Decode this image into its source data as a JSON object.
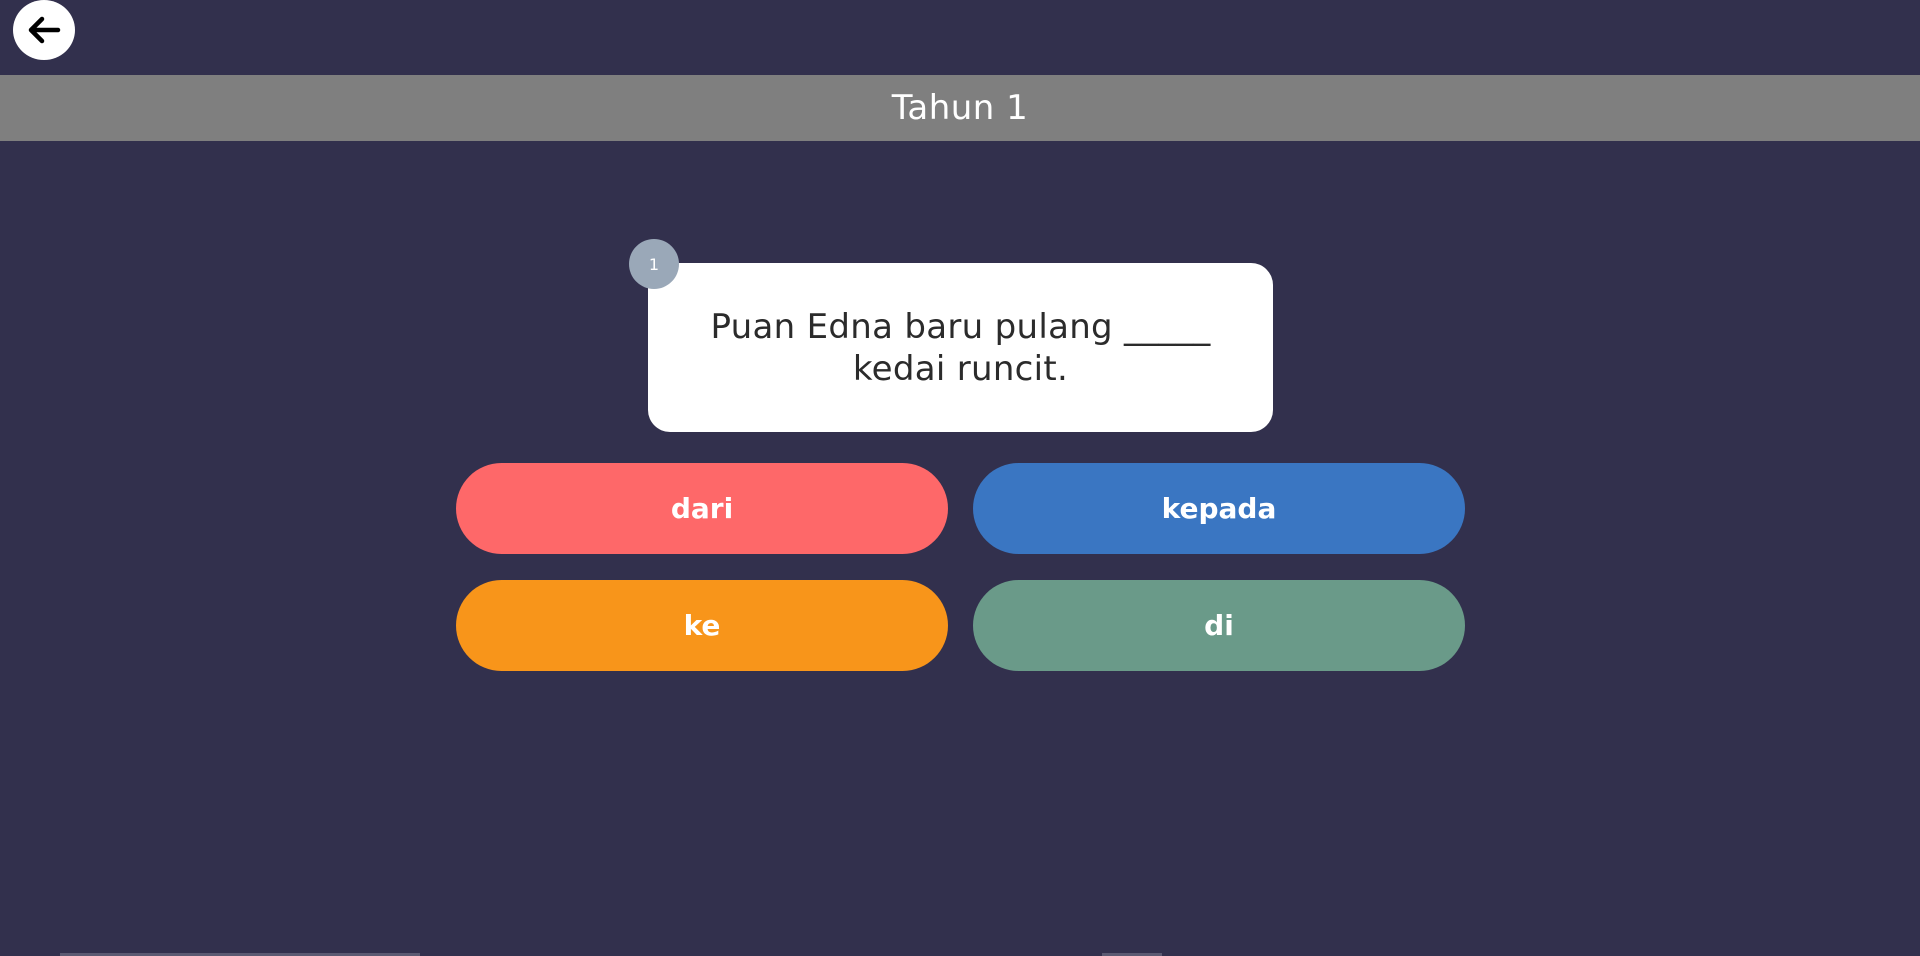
{
  "header": {
    "title": "Tahun 1"
  },
  "question": {
    "number": "1",
    "text": "Puan Edna baru pulang _____ kedai runcit."
  },
  "answers": [
    {
      "label": "dari",
      "color": "#fe6869"
    },
    {
      "label": "kepada",
      "color": "#3a76c2"
    },
    {
      "label": "ke",
      "color": "#f8951a"
    },
    {
      "label": "di",
      "color": "#6a9a89"
    }
  ],
  "colors": {
    "background": "#32304d",
    "title_bar": "#7f7f7f",
    "question_badge": "#9aa8b8"
  },
  "icons": {
    "back": "arrow-left-icon"
  }
}
